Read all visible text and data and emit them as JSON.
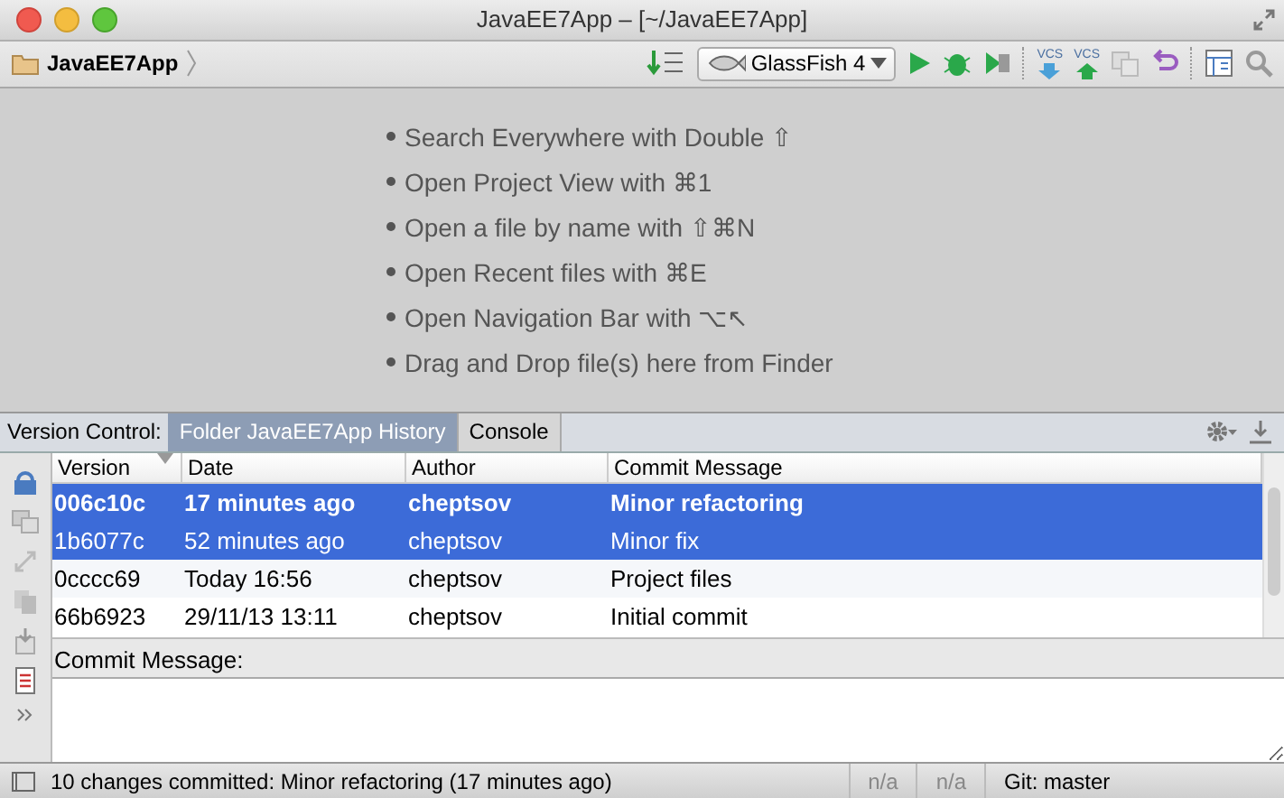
{
  "window": {
    "title": "JavaEE7App – [~/JavaEE7App]"
  },
  "toolbar": {
    "breadcrumb": "JavaEE7App",
    "run_config": "GlassFish 4",
    "vcs_update": "VCS",
    "vcs_commit": "VCS"
  },
  "editor_hints": [
    "Search Everywhere with Double ⇧",
    "Open Project View with ⌘1",
    "Open a file by name with ⇧⌘N",
    "Open Recent files with ⌘E",
    "Open Navigation Bar with ⌥↖",
    "Drag and Drop file(s) here from Finder"
  ],
  "tool_window": {
    "label": "Version Control:",
    "tabs": [
      {
        "label": "Folder JavaEE7App History",
        "selected": true
      },
      {
        "label": "Console",
        "selected": false
      }
    ]
  },
  "table": {
    "columns": [
      "Version",
      "Date",
      "Author",
      "Commit Message"
    ],
    "rows": [
      {
        "cells": [
          "006c10c",
          "17 minutes ago",
          "cheptsov",
          "Minor refactoring"
        ],
        "selected": true,
        "bold": true
      },
      {
        "cells": [
          "1b6077c",
          "52 minutes ago",
          "cheptsov",
          "Minor fix"
        ],
        "selected": true,
        "bold": false
      },
      {
        "cells": [
          "0cccc69",
          "Today 16:56",
          "cheptsov",
          "Project files"
        ],
        "selected": false,
        "bold": false
      },
      {
        "cells": [
          "66b6923",
          "29/11/13 13:11",
          "cheptsov",
          "Initial commit"
        ],
        "selected": false,
        "bold": false
      }
    ]
  },
  "commit_message": {
    "label": "Commit Message:"
  },
  "status_bar": {
    "message": "10 changes committed: Minor refactoring (17 minutes ago)",
    "fields": [
      "n/a",
      "n/a"
    ],
    "branch": "Git: master"
  }
}
